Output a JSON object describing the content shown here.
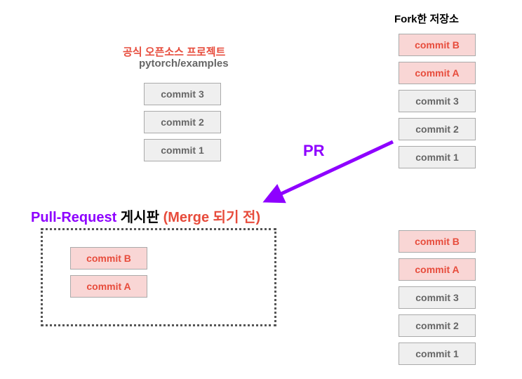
{
  "labels": {
    "official_project_title": "공식 오픈소스 프로젝트",
    "official_project_sub": "pytorch/examples",
    "fork_title": "Fork한 저장소",
    "pr_label": "PR",
    "pr_board_prefix": "Pull-Request ",
    "pr_board_mid": "게시판 ",
    "pr_board_suffix": "(Merge 되기 전)"
  },
  "official_commits": [
    "commit 3",
    "commit 2",
    "commit 1"
  ],
  "fork_commits_top": [
    "commit B",
    "commit A",
    "commit 3",
    "commit 2",
    "commit 1"
  ],
  "fork_commits_bottom": [
    "commit B",
    "commit A",
    "commit 3",
    "commit 2",
    "commit 1"
  ],
  "pr_panel_commits": [
    "commit B",
    "commit A"
  ],
  "colors": {
    "accent_red": "#e74c3c",
    "accent_purple": "#8e00ff",
    "gray_text": "#666666",
    "box_gray_bg": "#efefef",
    "box_red_bg": "#f9d6d5"
  }
}
